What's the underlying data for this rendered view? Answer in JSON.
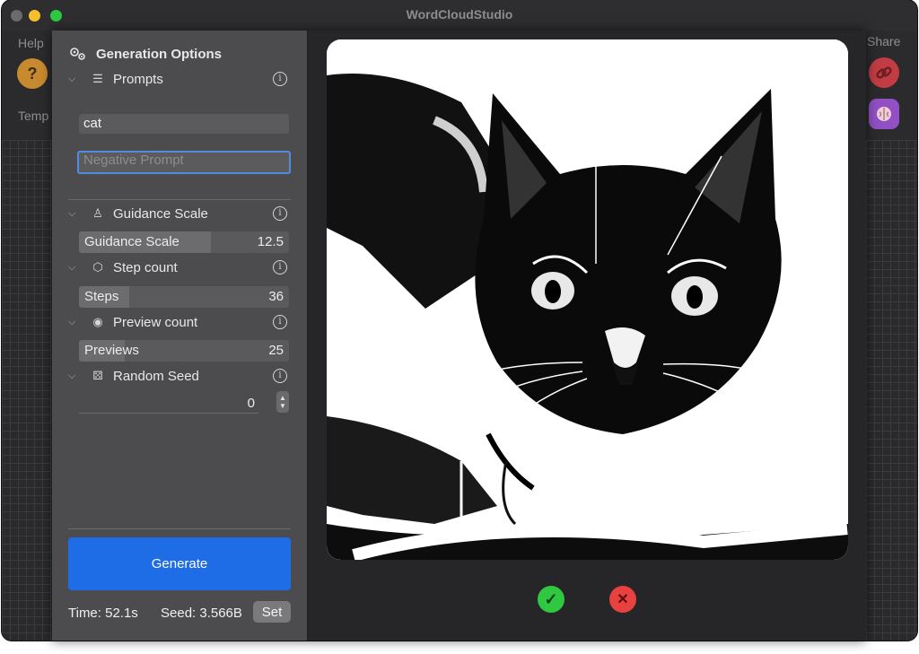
{
  "app": {
    "title": "WordCloudStudio"
  },
  "background": {
    "help_label": "Help",
    "share_label": "Share",
    "templates_label": "Temp",
    "help_icon_glyph": "?"
  },
  "panel": {
    "title": "Generation Options",
    "prompts": {
      "label": "Prompts",
      "prompt_value": "cat",
      "negative_placeholder": "Negative Prompt"
    },
    "guidance": {
      "label": "Guidance Scale",
      "slider_label": "Guidance Scale",
      "value": "12.5",
      "fraction": 0.63
    },
    "steps": {
      "label": "Step count",
      "slider_label": "Steps",
      "value": "36",
      "fraction": 0.24
    },
    "previews": {
      "label": "Preview count",
      "slider_label": "Previews",
      "value": "25",
      "fraction": 0.22
    },
    "seed": {
      "label": "Random Seed",
      "value": "0"
    },
    "generate_label": "Generate",
    "time_text": "Time: 52.1s",
    "seed_text": "Seed: 3.566B",
    "set_label": "Set"
  },
  "preview": {
    "accept_glyph": "✓",
    "reject_glyph": "✕"
  },
  "colors": {
    "accent": "#1e6ce6",
    "accept": "#2fc840",
    "reject": "#e94040",
    "help": "#e8a13a",
    "share": "#e0484f",
    "brain": "#a35bd6"
  },
  "icons": [
    "gears-icon",
    "chevron-down-icon",
    "list-icon",
    "info-icon",
    "weight-icon",
    "cube-icon",
    "eye-icon",
    "dice-icon",
    "stepper-icon",
    "checkmark-icon",
    "xmark-icon",
    "link-icon",
    "brain-icon",
    "question-icon"
  ]
}
